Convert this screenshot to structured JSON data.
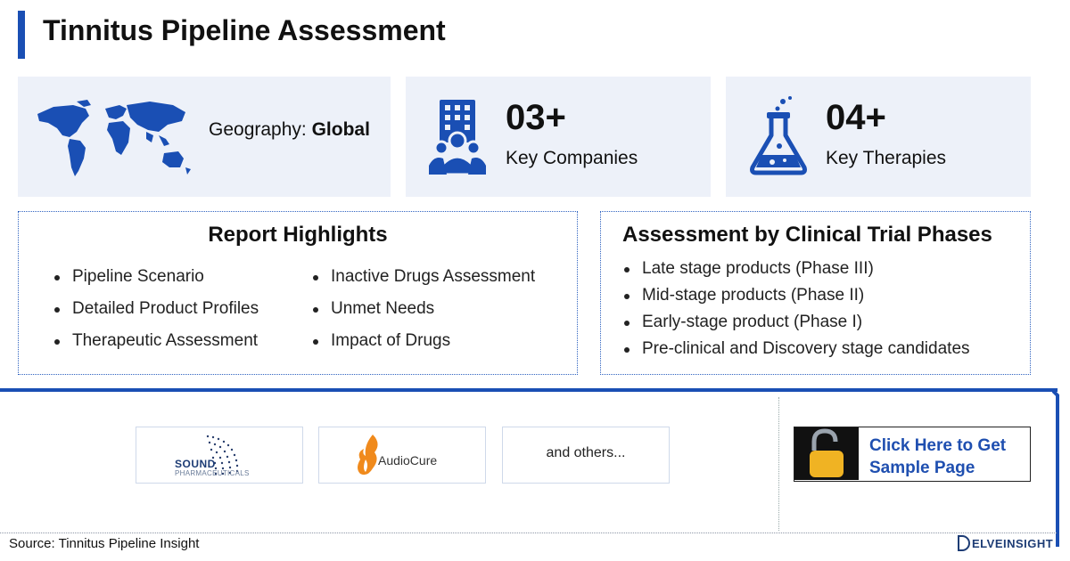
{
  "header": {
    "title": "Tinnitus Pipeline Assessment"
  },
  "stats": {
    "geography_label": "Geography:",
    "geography_value": "Global",
    "companies_number": "03+",
    "companies_label": "Key Companies",
    "therapies_number": "04+",
    "therapies_label": "Key Therapies",
    "icons": [
      "world-map-icon",
      "building-people-icon",
      "flask-icon"
    ]
  },
  "highlights": {
    "title": "Report Highlights",
    "column1": [
      "Pipeline Scenario",
      "Detailed Product Profiles",
      "Therapeutic Assessment"
    ],
    "column2": [
      "Inactive Drugs Assessment",
      "Unmet Needs",
      "Impact of Drugs"
    ]
  },
  "phases": {
    "title": "Assessment by Clinical Trial Phases",
    "items": [
      "Late stage products (Phase III)",
      "Mid-stage products (Phase II)",
      "Early-stage product (Phase I)",
      "Pre-clinical and Discovery stage candidates"
    ]
  },
  "companies": {
    "sound_name": "SOUND",
    "sound_sub": "PHARMACEUTICALS",
    "audiocure_name": "AudioCure",
    "others": "and others..."
  },
  "cta": {
    "label_line1": "Click Here to Get",
    "label_line2": "Sample Page",
    "icon": "unlocked-padlock-icon"
  },
  "footer": {
    "source": "Source: Tinnitus Pipeline Insight",
    "brand": "ELVEINSIGHT"
  },
  "colors": {
    "accent": "#1a4fb4",
    "card_bg": "#edf1f9",
    "link": "#1f4fb0",
    "lock": "#f0b323"
  }
}
